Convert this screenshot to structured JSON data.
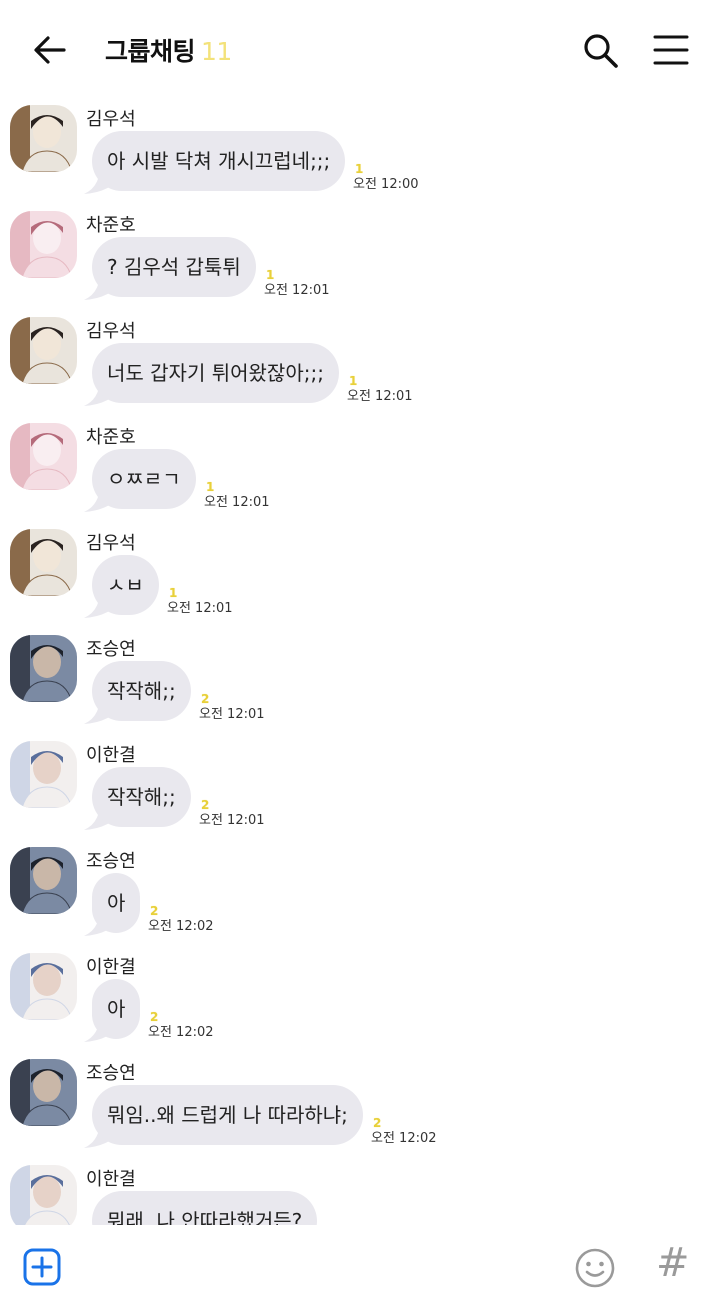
{
  "header": {
    "title": "그룹채팅",
    "member_count": "11"
  },
  "messages": [
    {
      "sender": "김우석",
      "text": "아 시발 닥쳐 개시끄럽네;;;",
      "unread": "1",
      "time": "오전 12:00",
      "avatar": "avatar-kimwooseok"
    },
    {
      "sender": "차준호",
      "text": "? 김우석 갑툭튀",
      "unread": "1",
      "time": "오전 12:01",
      "avatar": "avatar-chajunho"
    },
    {
      "sender": "김우석",
      "text": "너도 갑자기 튀어왔잖아;;;",
      "unread": "1",
      "time": "오전 12:01",
      "avatar": "avatar-kimwooseok"
    },
    {
      "sender": "차준호",
      "text": "ㅇㅉㄹㄱ",
      "unread": "1",
      "time": "오전 12:01",
      "avatar": "avatar-chajunho"
    },
    {
      "sender": "김우석",
      "text": "ㅅㅂ",
      "unread": "1",
      "time": "오전 12:01",
      "avatar": "avatar-kimwooseok"
    },
    {
      "sender": "조승연",
      "text": "작작해;;",
      "unread": "2",
      "time": "오전 12:01",
      "avatar": "avatar-joseungyoun"
    },
    {
      "sender": "이한결",
      "text": "작작해;;",
      "unread": "2",
      "time": "오전 12:01",
      "avatar": "avatar-leehangyul"
    },
    {
      "sender": "조승연",
      "text": "아",
      "unread": "2",
      "time": "오전 12:02",
      "avatar": "avatar-joseungyoun"
    },
    {
      "sender": "이한결",
      "text": "아",
      "unread": "2",
      "time": "오전 12:02",
      "avatar": "avatar-leehangyul"
    },
    {
      "sender": "조승연",
      "text": "뭐임..왜 드럽게 나 따라하냐;",
      "unread": "2",
      "time": "오전 12:02",
      "avatar": "avatar-joseungyoun"
    },
    {
      "sender": "이한결",
      "text": "뭐래, 나 안따라했거든?",
      "unread": "",
      "time": "",
      "avatar": "avatar-leehangyul"
    }
  ],
  "icons": {
    "back": "arrow-left-icon",
    "search": "search-icon",
    "menu": "hamburger-menu-icon",
    "plus": "plus-square-icon",
    "emoji": "smiley-icon",
    "hash": "hashtag-icon"
  },
  "bottom": {
    "hash_glyph": "#"
  },
  "colors": {
    "bubble": "#e9e8ee",
    "unread": "#e8d03a",
    "accent": "#1a73e8",
    "count": "#f3e27a"
  }
}
